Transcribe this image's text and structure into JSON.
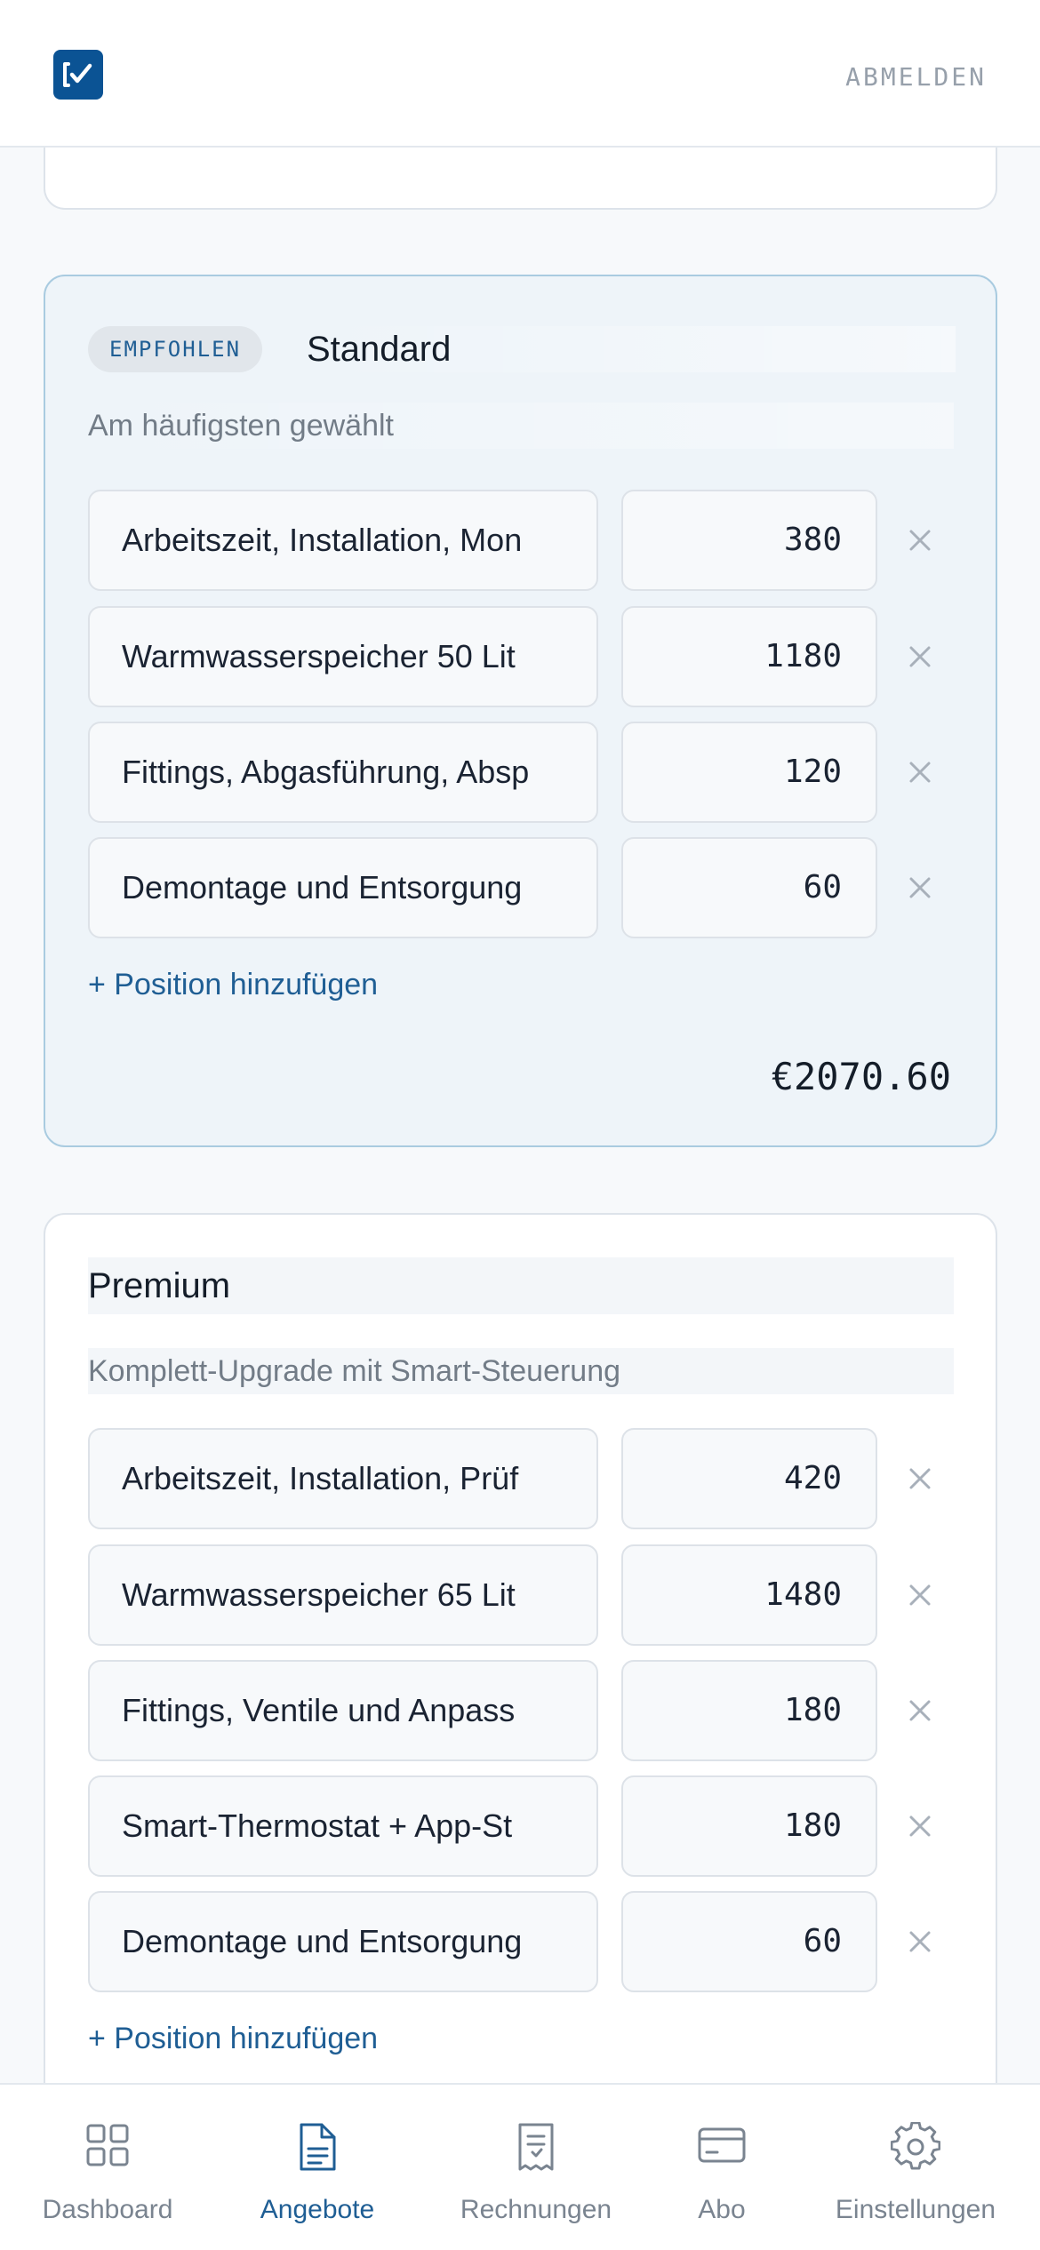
{
  "header": {
    "logo_icon": "checkbox-bracket-icon",
    "signout_label": "ABMELDEN",
    "colors": {
      "brand": "#0b5394",
      "muted": "#97a0ab"
    }
  },
  "tiers": [
    {
      "badge": "EMPFOHLEN",
      "name": "Standard",
      "description": "Am häufigsten gewählt",
      "items": [
        {
          "description": "Arbeitszeit, Installation, Mon",
          "price": "380"
        },
        {
          "description": "Warmwasserspeicher 50 Lit",
          "price": "1180"
        },
        {
          "description": "Fittings, Abgasführung, Absp",
          "price": "120"
        },
        {
          "description": "Demontage und Entsorgung",
          "price": "60"
        }
      ],
      "add_label": "+ Position hinzufügen",
      "total": "€2070.60",
      "colors": {
        "background": "#eef4f9",
        "border": "#a9cbe0"
      }
    },
    {
      "name": "Premium",
      "description": "Komplett-Upgrade mit Smart-Steuerung",
      "items": [
        {
          "description": "Arbeitszeit, Installation, Prüf",
          "price": "420"
        },
        {
          "description": "Warmwasserspeicher 65 Lit",
          "price": "1480"
        },
        {
          "description": "Fittings, Ventile und Anpass",
          "price": "180"
        },
        {
          "description": "Smart-Thermostat + App-St",
          "price": "180"
        },
        {
          "description": "Demontage und Entsorgung",
          "price": "60"
        }
      ],
      "add_label": "+ Position hinzufügen"
    }
  ],
  "nav": {
    "active": "Angebote",
    "items": [
      {
        "label": "Dashboard",
        "icon": "grid-icon"
      },
      {
        "label": "Angebote",
        "icon": "document-icon"
      },
      {
        "label": "Rechnungen",
        "icon": "receipt-icon"
      },
      {
        "label": "Abo",
        "icon": "credit-card-icon"
      },
      {
        "label": "Einstellungen",
        "icon": "gear-icon"
      }
    ],
    "colors": {
      "active": "#1f5e94",
      "inactive": "#7a8490"
    }
  }
}
